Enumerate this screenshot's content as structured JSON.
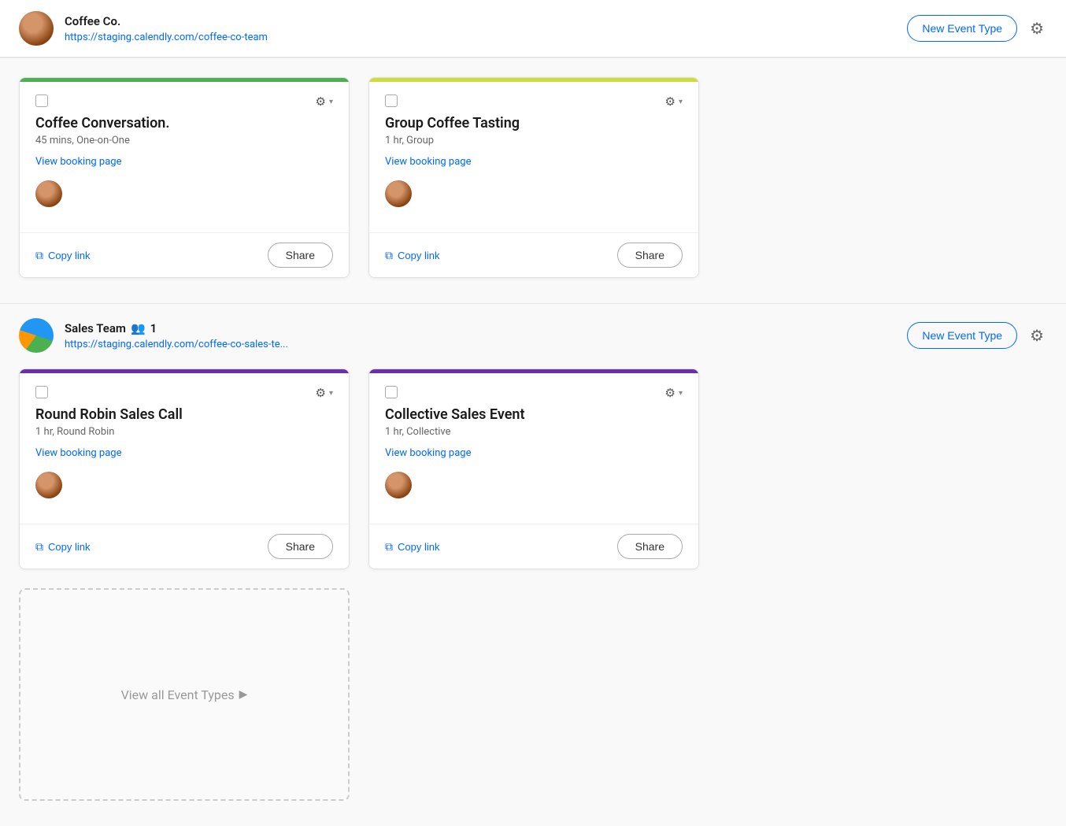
{
  "org1": {
    "name": "Coffee Co.",
    "url": "https://staging.calendly.com/coffee-co-team",
    "new_event_label": "New Event Type"
  },
  "org2": {
    "name": "Sales Team",
    "members_icon": "👥",
    "member_count": "1",
    "url": "https://staging.calendly.com/coffee-co-sales-te...",
    "new_event_label": "New Event Type"
  },
  "cards_org1": [
    {
      "id": "card1",
      "title": "Coffee Conversation.",
      "subtitle": "45 mins, One-on-One",
      "view_link_text": "View booking page",
      "copy_label": "Copy link",
      "share_label": "Share",
      "accent_color": "#4CAF50"
    },
    {
      "id": "card2",
      "title": "Group Coffee Tasting",
      "subtitle": "1 hr, Group",
      "view_link_text": "View booking page",
      "copy_label": "Copy link",
      "share_label": "Share",
      "accent_color": "#CDDC39"
    }
  ],
  "cards_org2": [
    {
      "id": "card3",
      "title": "Round Robin Sales Call",
      "subtitle": "1 hr, Round Robin",
      "view_link_text": "View booking page",
      "copy_label": "Copy link",
      "share_label": "Share",
      "accent_color": "#6B2FAC"
    },
    {
      "id": "card4",
      "title": "Collective Sales Event",
      "subtitle": "1 hr, Collective",
      "view_link_text": "View booking page",
      "copy_label": "Copy link",
      "share_label": "Share",
      "accent_color": "#6B2FAC"
    }
  ],
  "dashed_card": {
    "label": "View all Event Types"
  },
  "icons": {
    "gear": "⚙",
    "chevron_down": "▾",
    "copy": "⧉",
    "arrow_right": "▶",
    "users": "👥"
  }
}
